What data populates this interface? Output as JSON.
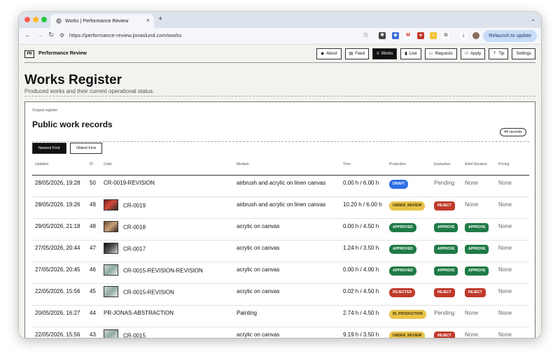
{
  "browser": {
    "tab_title": "Works | Performance Review",
    "url": "https://performance-review.jonaslund.com/works",
    "relaunch_label": "Relaunch to update"
  },
  "header": {
    "brand_mark": "PR",
    "brand": "Performance Review",
    "nav": [
      {
        "label": "About",
        "icon": "diamond-icon",
        "active": false
      },
      {
        "label": "Feed",
        "icon": "feed-icon",
        "active": false
      },
      {
        "label": "Works",
        "icon": "list-icon",
        "active": true
      },
      {
        "label": "Live",
        "icon": "signal-icon",
        "active": false
      },
      {
        "label": "Requests",
        "icon": "inbox-icon",
        "active": false
      },
      {
        "label": "Apply",
        "icon": "user-plus-icon",
        "active": false
      },
      {
        "label": "Tip",
        "icon": "tip-icon",
        "active": false
      },
      {
        "label": "Settings",
        "icon": "",
        "active": false
      }
    ]
  },
  "page": {
    "title": "Works Register",
    "subtitle": "Produced works and their current operational status."
  },
  "register": {
    "eyebrow": "Output register",
    "title": "Public work records",
    "count": "44 records",
    "sort_newest": "Newest First",
    "sort_oldest": "Oldest First",
    "columns": [
      "Updated",
      "ID",
      "Code",
      "Medium",
      "Time",
      "Production",
      "Evaluation",
      "Artist Decision",
      "Pricing"
    ],
    "rows": [
      {
        "updated": "28/05/2026, 19:28",
        "id": "50",
        "code": "CR-0019-REVISION",
        "thumb": "",
        "medium": "airbrush and acrylic on linen canvas",
        "time": "0.00 h / 6.00 h",
        "production": "DRAFT",
        "evaluation": "Pending",
        "decision": "None",
        "pricing": "None"
      },
      {
        "updated": "28/05/2026, 19:26",
        "id": "49",
        "code": "CR-0019",
        "thumb": "red",
        "medium": "airbrush and acrylic on linen canvas",
        "time": "10.20 h / 6.00 h",
        "production": "UNDER_REVIEW",
        "evaluation": "REJECT",
        "decision": "None",
        "pricing": "None"
      },
      {
        "updated": "29/05/2026, 21:18",
        "id": "48",
        "code": "CR-0018",
        "thumb": "brown",
        "medium": "acrylic on canvas",
        "time": "0.00 h / 4.50 h",
        "production": "APPROVED",
        "evaluation": "APPROVE",
        "decision": "APPROVE",
        "pricing": "None"
      },
      {
        "updated": "27/05/2026, 20:44",
        "id": "47",
        "code": "CR-0017",
        "thumb": "dark",
        "medium": "acrylic on canvas",
        "time": "1.24 h / 3.50 h",
        "production": "APPROVED",
        "evaluation": "APPROVE",
        "decision": "APPROVE",
        "pricing": "None"
      },
      {
        "updated": "27/05/2026, 20:45",
        "id": "46",
        "code": "CR-0015-REVISION-REVISION",
        "thumb": "pale",
        "medium": "acrylic on canvas",
        "time": "0.00 h / 4.00 h",
        "production": "APPROVED",
        "evaluation": "APPROVE",
        "decision": "APPROVE",
        "pricing": "None"
      },
      {
        "updated": "22/05/2026, 15:56",
        "id": "45",
        "code": "CR-0015-REVISION",
        "thumb": "pale",
        "medium": "acrylic on canvas",
        "time": "0.02 h / 4.50 h",
        "production": "REJECTED",
        "evaluation": "REJECT",
        "decision": "REJECT",
        "pricing": "None"
      },
      {
        "updated": "20/05/2026, 16:27",
        "id": "44",
        "code": "PR-JONAS-ABSTRACTION",
        "thumb": "",
        "medium": "Painting",
        "time": "2.74 h / 4.50 h",
        "production": "IN_PRODUCTION",
        "evaluation": "Pending",
        "decision": "None",
        "pricing": "None"
      },
      {
        "updated": "22/05/2026, 15:56",
        "id": "43",
        "code": "CR-0015",
        "thumb": "pale",
        "medium": "acrylic on canvas",
        "time": "9.19 h / 3.50 h",
        "production": "UNDER_REVIEW",
        "evaluation": "REJECT",
        "decision": "None",
        "pricing": "None"
      }
    ]
  },
  "colors": {
    "DRAFT": "#2f6fe4",
    "UNDER_REVIEW": "#e8c44a",
    "APPROVED": "#1f7a45",
    "REJECTED": "#c0392b",
    "IN_PRODUCTION": "#e8c44a",
    "APPROVE": "#1f7a45",
    "REJECT": "#c0392b"
  }
}
